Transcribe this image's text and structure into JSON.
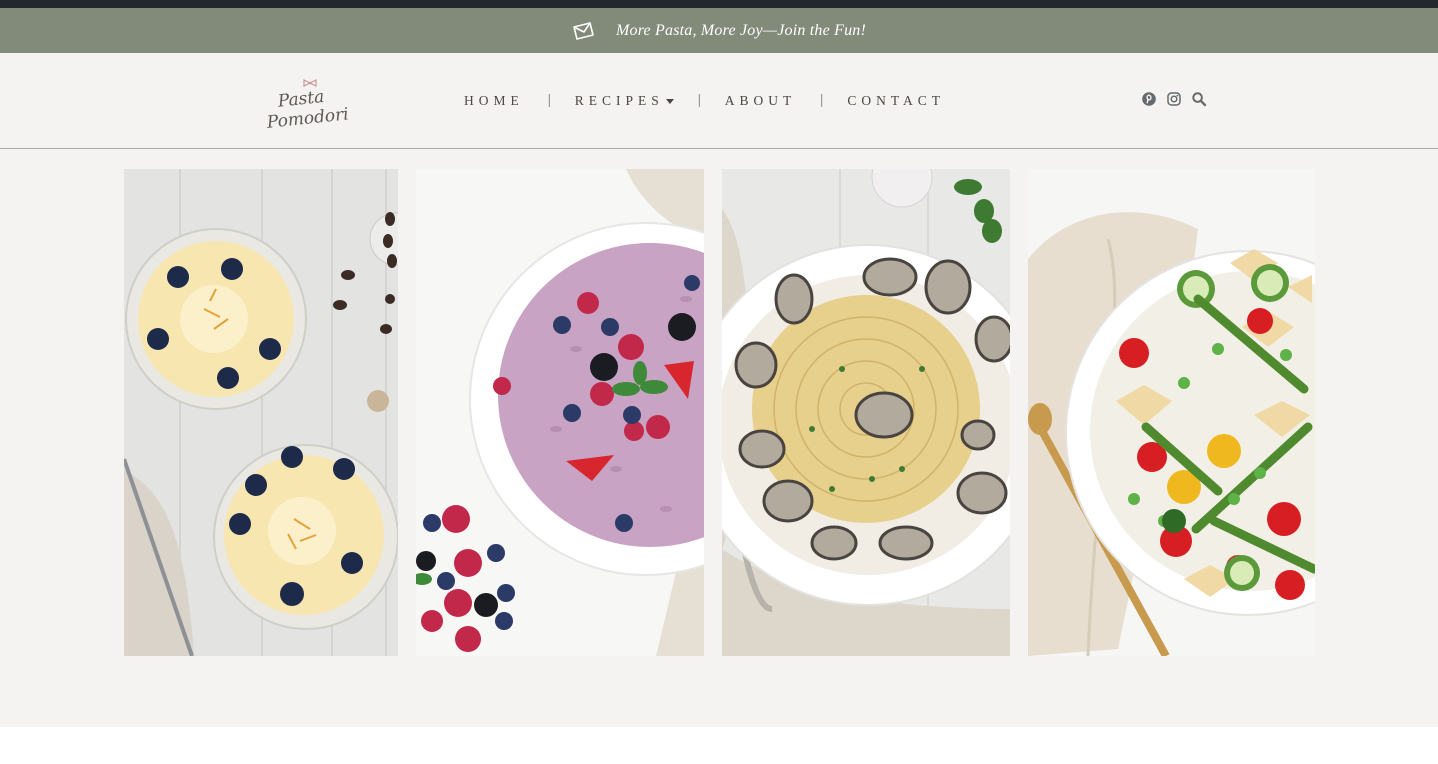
{
  "promo_bar": {
    "icon": "mail-icon",
    "text": "More Pasta, More Joy—Join the Fun!"
  },
  "header": {
    "logo": {
      "line1": "Pasta",
      "line2": "Pomodori"
    },
    "nav": {
      "items": [
        {
          "label": "HOME"
        },
        {
          "label": "RECIPES",
          "has_dropdown": true
        },
        {
          "label": "ABOUT"
        },
        {
          "label": "CONTACT"
        }
      ],
      "separator": "|"
    },
    "icons": [
      "pinterest-icon",
      "instagram-icon",
      "search-icon"
    ]
  },
  "gallery": {
    "cards": [
      {
        "image": "custard-blueberry-cups"
      },
      {
        "image": "berry-risotto-bowl"
      },
      {
        "image": "spaghetti-clams-bowl"
      },
      {
        "image": "farfalle-vegetable-salad"
      }
    ]
  },
  "colors": {
    "promo_bg": "#828a7a",
    "header_bg": "#f4f3f1",
    "top_strip": "#23282e",
    "nav_text": "#4c4640"
  }
}
